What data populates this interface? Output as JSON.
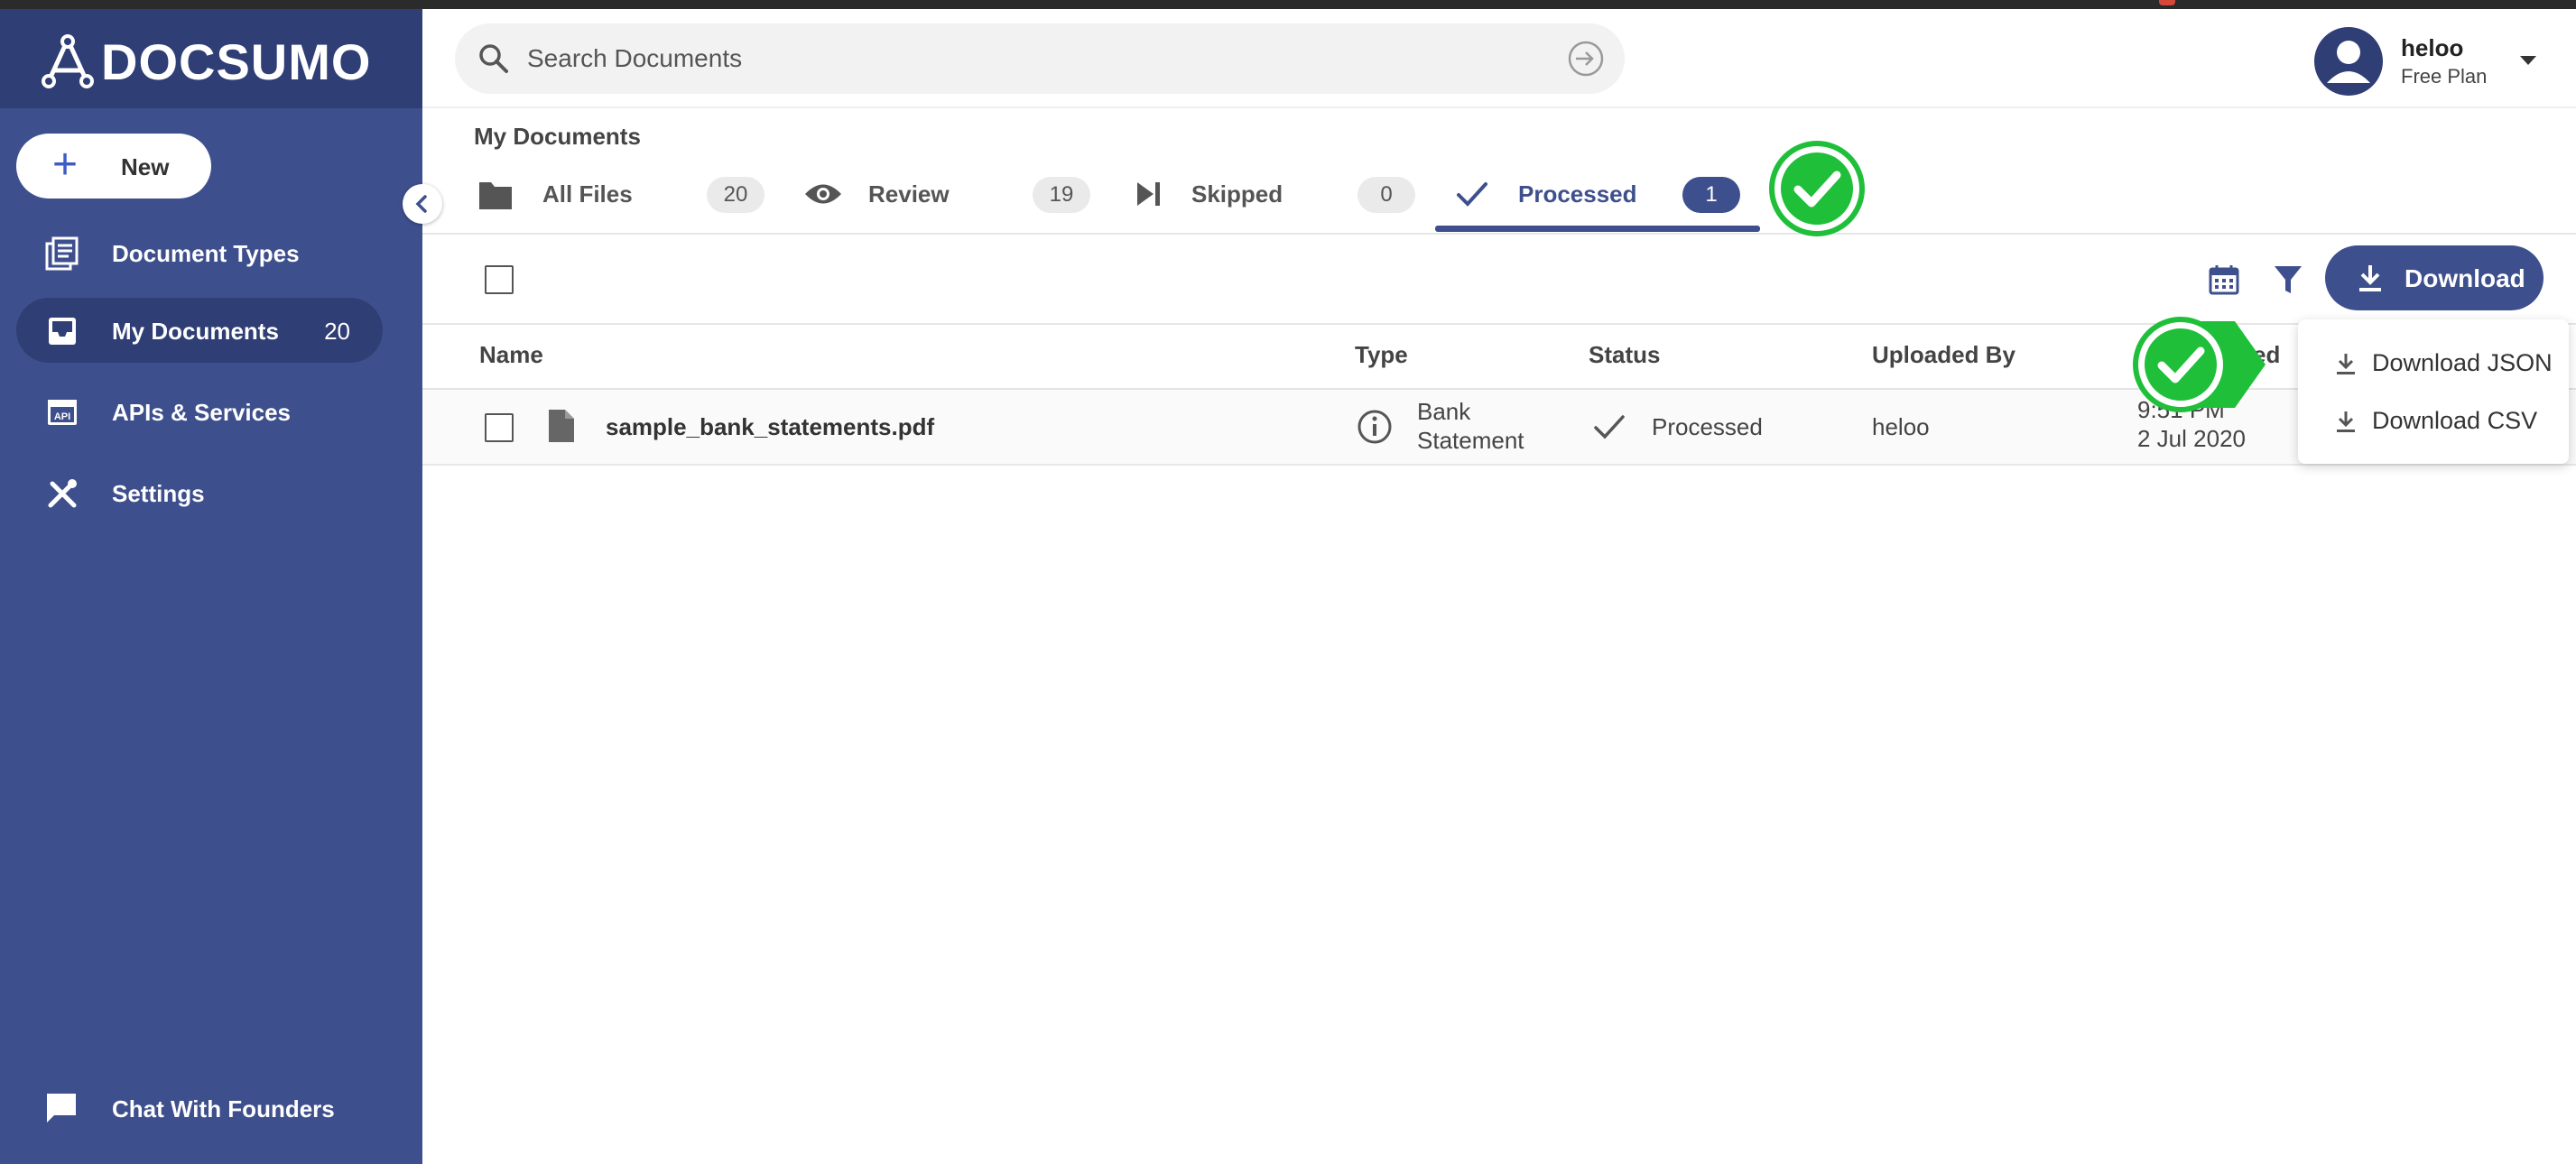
{
  "app": {
    "logo_text": "DOCSUMO",
    "brand_color": "#3e4f8d",
    "sidebar_dark_color": "#2f3e75"
  },
  "sidebar": {
    "new_label": "New",
    "items": [
      {
        "label": "Document Types",
        "icon": "document-types-icon"
      },
      {
        "label": "My Documents",
        "icon": "inbox-icon",
        "count": "20",
        "active": true
      },
      {
        "label": "APIs & Services",
        "icon": "api-icon"
      },
      {
        "label": "Settings",
        "icon": "tools-icon"
      }
    ],
    "chat_label": "Chat With Founders"
  },
  "header": {
    "search_placeholder": "Search Documents",
    "user_name": "heloo",
    "user_plan": "Free Plan"
  },
  "main": {
    "breadcrumb": "My Documents",
    "tabs": [
      {
        "label": "All Files",
        "count": "20",
        "icon": "folder-icon"
      },
      {
        "label": "Review",
        "count": "19",
        "icon": "eye-icon"
      },
      {
        "label": "Skipped",
        "count": "0",
        "icon": "skip-icon"
      },
      {
        "label": "Processed",
        "count": "1",
        "icon": "check-icon",
        "active": true
      }
    ],
    "download_label": "Download",
    "download_menu": [
      "Download JSON",
      "Download CSV"
    ],
    "columns": [
      "Name",
      "Type",
      "Status",
      "Uploaded By",
      "ed"
    ],
    "rows": [
      {
        "name": "sample_bank_statements.pdf",
        "type_line1": "Bank",
        "type_line2": "Statement",
        "status": "Processed",
        "uploaded_by": "heloo",
        "time_line1": "9:51 PM",
        "time_line2": "2 Jul 2020"
      }
    ]
  },
  "annotations": {
    "marker_color": "#1fbf3a",
    "markers": [
      "check-marker-processed-tab",
      "check-marker-download-json"
    ]
  }
}
